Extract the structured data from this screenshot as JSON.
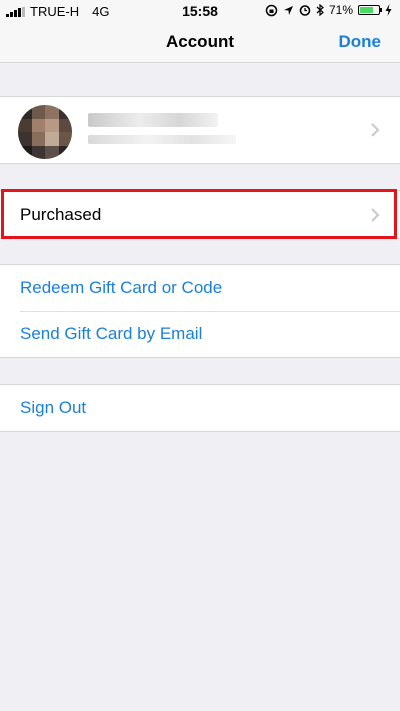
{
  "status_bar": {
    "carrier": "TRUE-H",
    "network": "4G",
    "time": "15:58",
    "battery_percent": "71%",
    "battery_level": 0.71,
    "icons": [
      "lock-rotation-icon",
      "location-arrow-icon",
      "alarm-icon",
      "bluetooth-icon",
      "battery-icon",
      "charging-icon"
    ]
  },
  "nav": {
    "title": "Account",
    "done_label": "Done"
  },
  "profile": {
    "name": "",
    "email": ""
  },
  "purchased": {
    "label": "Purchased"
  },
  "gift": {
    "redeem_label": "Redeem Gift Card or Code",
    "send_label": "Send Gift Card by Email"
  },
  "signout": {
    "label": "Sign Out"
  },
  "colors": {
    "accent": "#1a80d8",
    "background": "#efeff4",
    "highlight": "#e4141b",
    "battery": "#4cd964"
  }
}
